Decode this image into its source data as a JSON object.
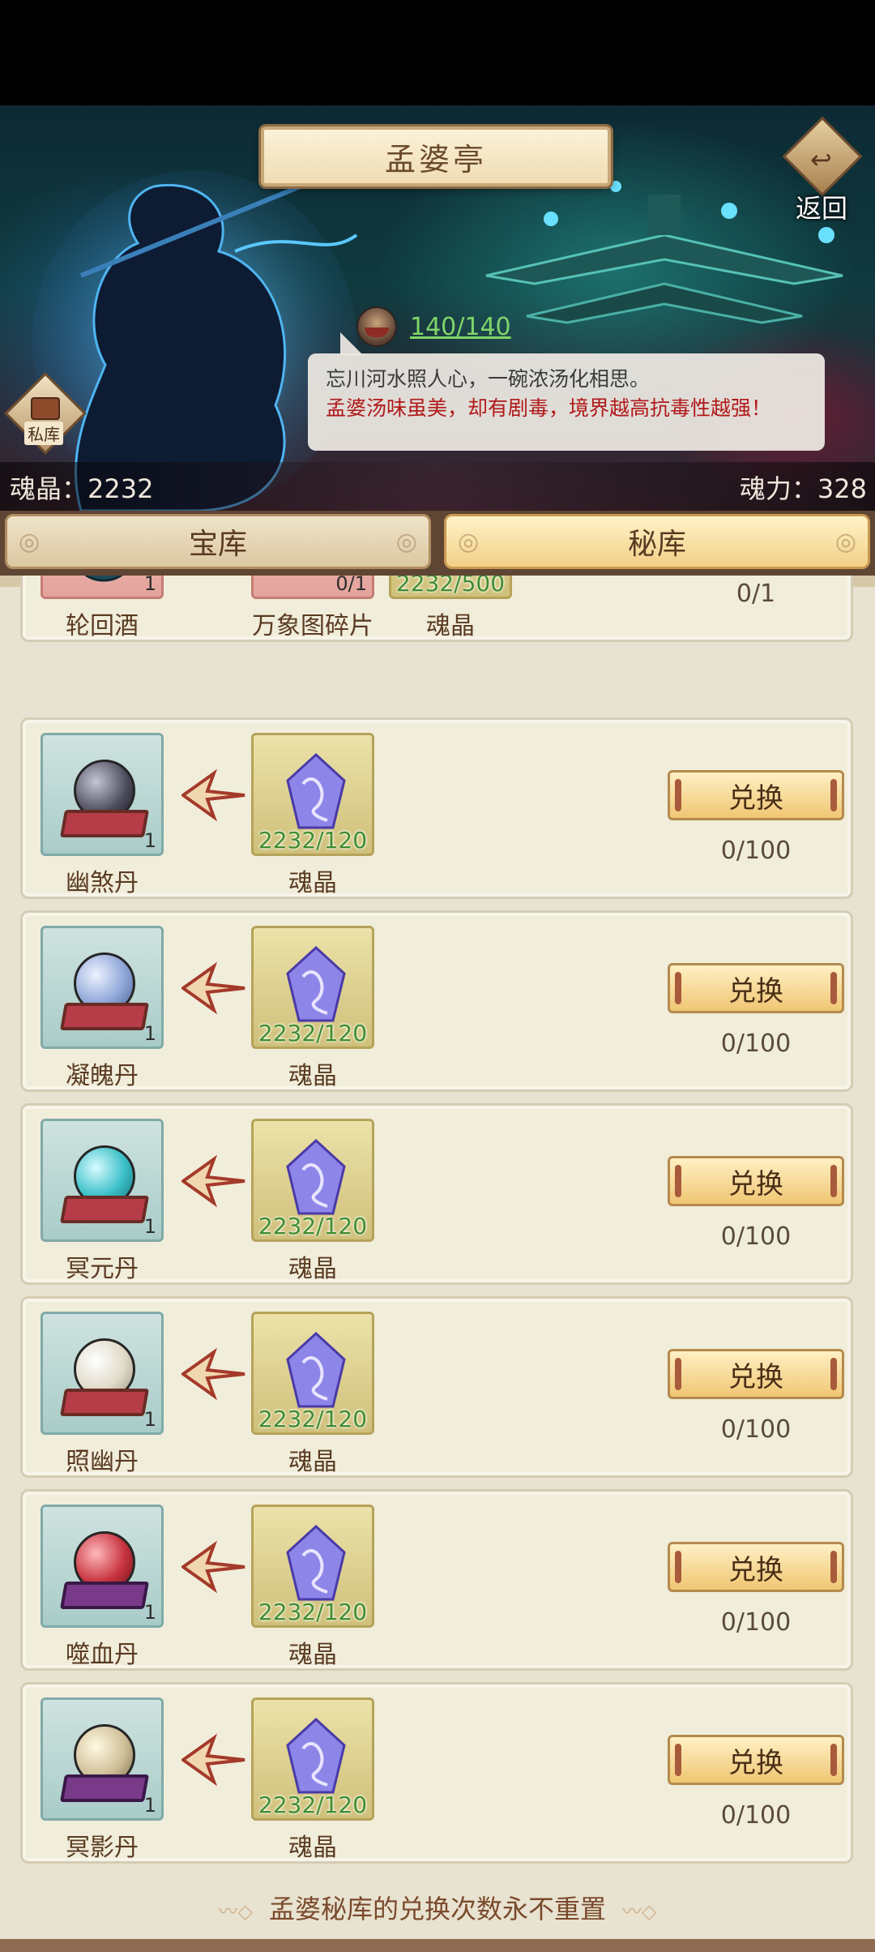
{
  "header": {
    "title": "孟婆亭",
    "back_label": "返回",
    "stamina": "140/140",
    "speech_line1": "忘川河水照人心，一碗浓汤化相思。",
    "speech_line2": "孟婆汤味虽美，却有剧毒，境界越高抗毒性越强！",
    "vault_badge": "私库",
    "soul_crystal": "魂晶：2232",
    "soul_power": "魂力：328"
  },
  "tabs": {
    "treasury": "宝库",
    "secret": "秘库",
    "active": "秘库"
  },
  "button_label": "兑换",
  "rows": [
    {
      "product": "轮回酒",
      "product_qty": "1",
      "cost2": "万象图碎片",
      "cost2_qty": "0/1",
      "cost": "魂晶",
      "cost_qty": "2232/500",
      "limit": "0/1"
    },
    {
      "product": "幽煞丹",
      "product_qty": "1",
      "cost": "魂晶",
      "cost_qty": "2232/120",
      "limit": "0/100",
      "orb_color": "#4a4a5a"
    },
    {
      "product": "凝魄丹",
      "product_qty": "1",
      "cost": "魂晶",
      "cost_qty": "2232/120",
      "limit": "0/100",
      "orb_color": "#8fa7d8"
    },
    {
      "product": "冥元丹",
      "product_qty": "1",
      "cost": "魂晶",
      "cost_qty": "2232/120",
      "limit": "0/100",
      "orb_color": "#3bc0c8"
    },
    {
      "product": "照幽丹",
      "product_qty": "1",
      "cost": "魂晶",
      "cost_qty": "2232/120",
      "limit": "0/100",
      "orb_color": "#e0dac8"
    },
    {
      "product": "噬血丹",
      "product_qty": "1",
      "cost": "魂晶",
      "cost_qty": "2232/120",
      "limit": "0/100",
      "orb_color": "#c8343f"
    },
    {
      "product": "冥影丹",
      "product_qty": "1",
      "cost": "魂晶",
      "cost_qty": "2232/120",
      "limit": "0/100",
      "orb_color": "#d0c09a"
    }
  ],
  "footer_note": "孟婆秘库的兑换次数永不重置"
}
